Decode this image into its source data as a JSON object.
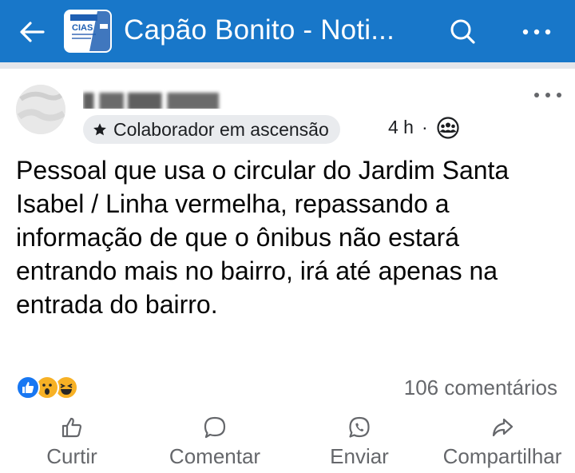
{
  "header": {
    "group_title": "Capão Bonito - Noti...",
    "group_thumb_text": "CIAS",
    "icons": [
      "back-arrow-icon",
      "search-icon",
      "more-horizontal-icon"
    ],
    "bar_color": "#1877c9"
  },
  "post": {
    "badge_label": "Colaborador em ascensão",
    "time": "4 h",
    "separator": "·",
    "text": "Pessoal que usa o circular do Jardim Santa Isabel / Linha vermelha, repassando a informação de que o ônibus não estará entrando mais no bairro, irá até apenas na entrada do bairro.",
    "reactions": [
      "like",
      "wow",
      "haha"
    ],
    "comments_count": "106 comentários"
  },
  "actions": {
    "like": "Curtir",
    "comment": "Comentar",
    "send": "Enviar",
    "share": "Compartilhar"
  }
}
